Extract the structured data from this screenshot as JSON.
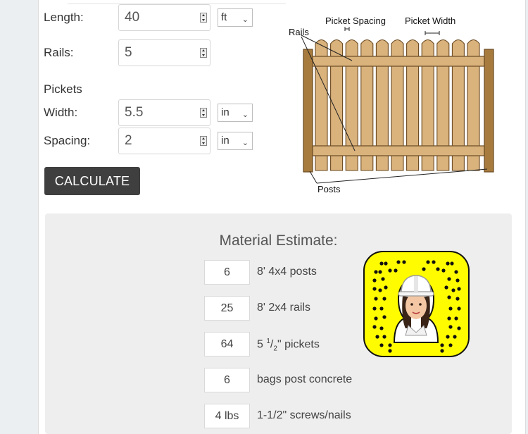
{
  "form": {
    "length_label": "Length:",
    "length_value": "40",
    "length_unit": "ft",
    "rails_label": "Rails:",
    "rails_value": "5",
    "pickets_heading": "Pickets",
    "width_label": "Width:",
    "width_value": "5.5",
    "width_unit": "in",
    "spacing_label": "Spacing:",
    "spacing_value": "2",
    "spacing_unit": "in",
    "calculate_label": "CALCULATE"
  },
  "diagram": {
    "picket_spacing_label": "Picket Spacing",
    "picket_width_label": "Picket Width",
    "rails_label": "Rails",
    "posts_label": "Posts",
    "wood_color": "#d9b27c",
    "post_color": "#a77b3e",
    "outline_color": "#6b4a22"
  },
  "estimate": {
    "title": "Material Estimate:",
    "posts_qty": "6",
    "posts_desc": "8' 4x4 posts",
    "rails_qty": "25",
    "rails_desc": "8' 2x4 rails",
    "pickets_qty": "64",
    "pickets_whole": "5",
    "pickets_num": "1",
    "pickets_den": "2",
    "pickets_suffix": "\" pickets",
    "concrete_qty": "6",
    "concrete_desc": "bags post concrete",
    "screws_qty": "4 lbs",
    "screws_desc": "1-1/2\" screws/nails"
  },
  "snapcode": {
    "background_color": "#fffc00",
    "icon": "snapcode-bitmoji-hardhat-icon"
  }
}
